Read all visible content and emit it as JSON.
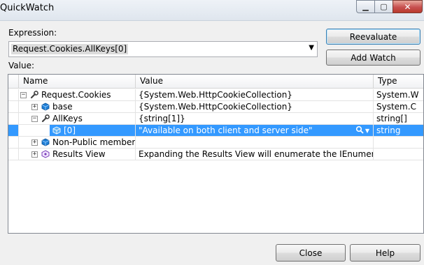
{
  "window": {
    "title": "QuickWatch"
  },
  "expression": {
    "label": "Expression:",
    "value": "Request.Cookies.AllKeys[0]"
  },
  "buttons": {
    "reevaluate": "Reevaluate",
    "add_watch": "Add Watch",
    "close": "Close",
    "help": "Help"
  },
  "value_label": "Value:",
  "grid": {
    "columns": [
      "Name",
      "Value",
      "Type"
    ],
    "rows": [
      {
        "name": "Request.Cookies",
        "value": "{System.Web.HttpCookieCollection}",
        "type": "System.W",
        "expander": "−",
        "icon": "wrench-icon",
        "depth": 0
      },
      {
        "name": "base",
        "value": "{System.Web.HttpCookieCollection}",
        "type": "System.C",
        "expander": "+",
        "icon": "class-field-icon",
        "depth": 1
      },
      {
        "name": "AllKeys",
        "value": "{string[1]}",
        "type": "string[]",
        "expander": "−",
        "icon": "wrench-icon",
        "depth": 1
      },
      {
        "name": "[0]",
        "value": "\"Available on both client and server side\"",
        "type": "string",
        "expander": "",
        "icon": "element-icon",
        "depth": 2,
        "selected": true
      },
      {
        "name": "Non-Public members",
        "value": "",
        "type": "",
        "expander": "+",
        "icon": "folder-icon",
        "depth": 1
      },
      {
        "name": "Results View",
        "value": "Expanding the Results View will enumerate the IEnumerable",
        "type": "",
        "expander": "+",
        "icon": "results-view-icon",
        "depth": 1
      }
    ]
  }
}
